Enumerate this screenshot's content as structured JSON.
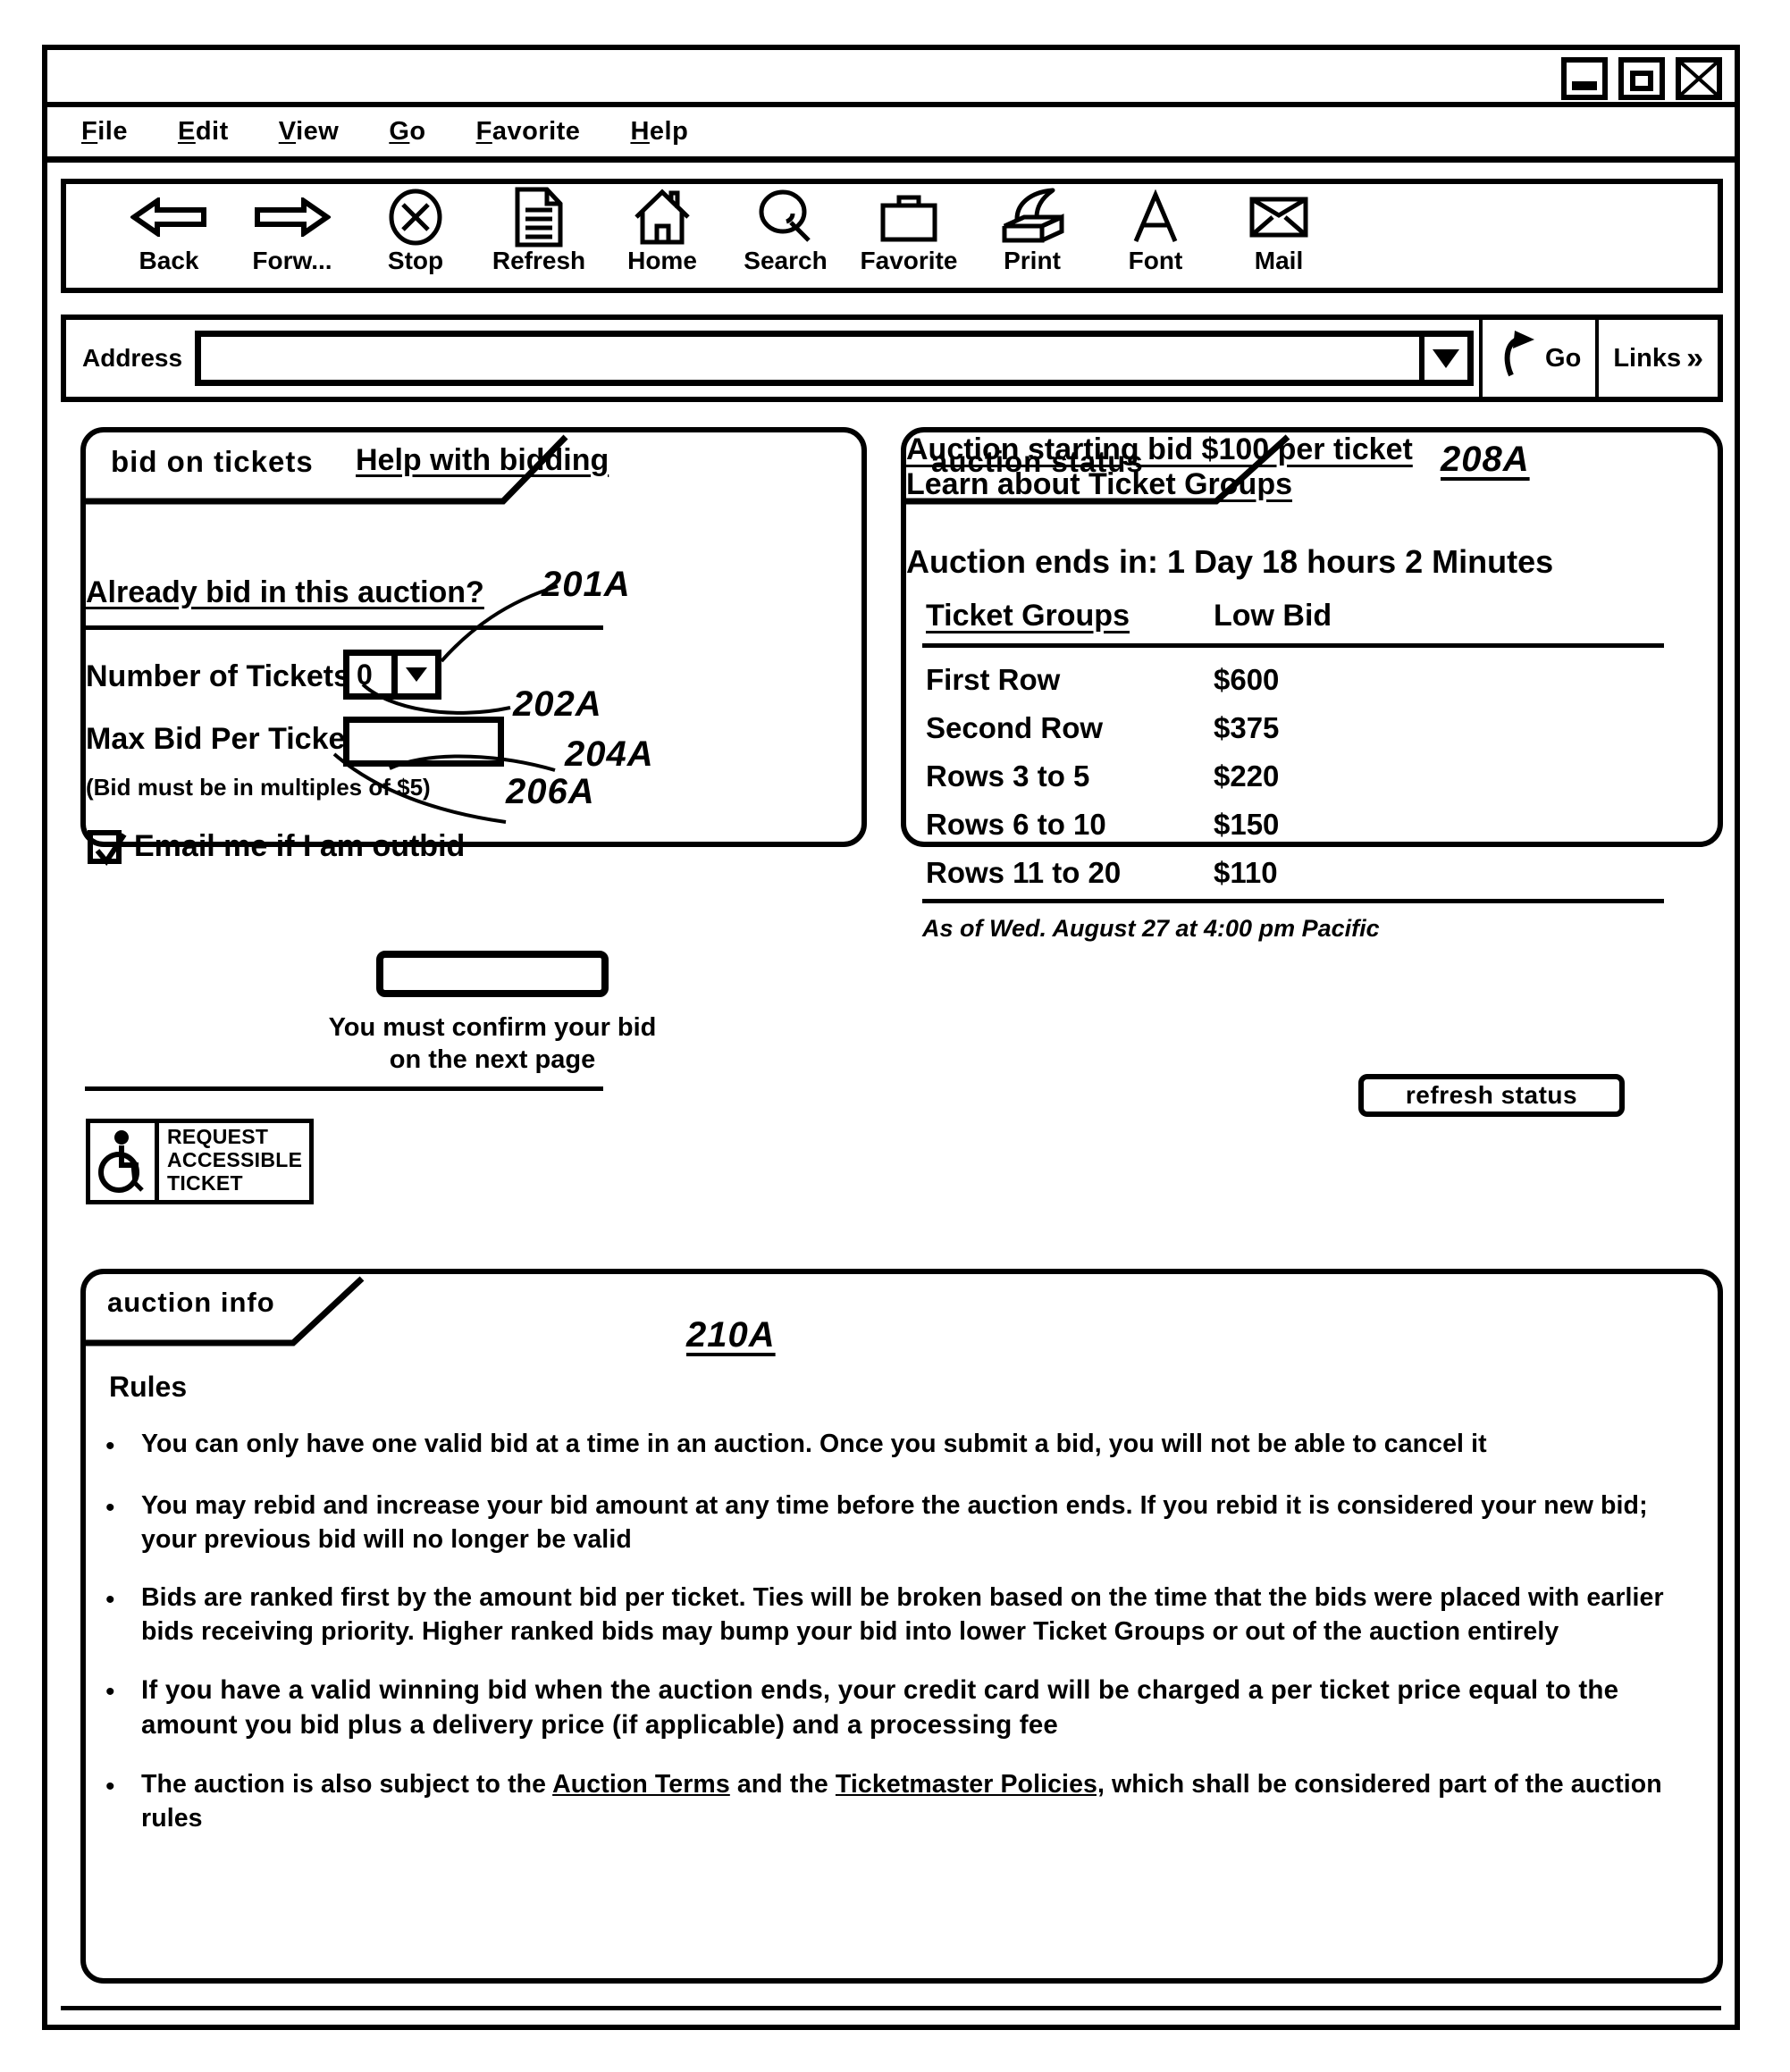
{
  "window": {
    "controls": [
      {
        "name": "minimize",
        "glyph": "minimize-icon"
      },
      {
        "name": "maximize",
        "glyph": "maximize-icon"
      },
      {
        "name": "close",
        "glyph": "close-icon"
      }
    ]
  },
  "menubar": {
    "items": [
      {
        "label": "File",
        "accel": "F"
      },
      {
        "label": "Edit",
        "accel": "E"
      },
      {
        "label": "View",
        "accel": "V"
      },
      {
        "label": "Go",
        "accel": "G"
      },
      {
        "label": "Favorite",
        "accel": "F"
      },
      {
        "label": "Help",
        "accel": "H"
      }
    ]
  },
  "toolbar": {
    "buttons": [
      {
        "label": "Back",
        "icon": "arrow-left-icon"
      },
      {
        "label": "Forw...",
        "icon": "arrow-right-icon"
      },
      {
        "label": "Stop",
        "icon": "stop-x-circle-icon"
      },
      {
        "label": "Refresh",
        "icon": "document-icon"
      },
      {
        "label": "Home",
        "icon": "house-icon"
      },
      {
        "label": "Search",
        "icon": "magnifier-icon"
      },
      {
        "label": "Favorite",
        "icon": "briefcase-icon"
      },
      {
        "label": "Print",
        "icon": "printer-icon"
      },
      {
        "label": "Font",
        "icon": "letter-a-icon"
      },
      {
        "label": "Mail",
        "icon": "envelope-icon"
      }
    ]
  },
  "address_bar": {
    "label": "Address",
    "value": "",
    "placeholder": "",
    "dropdown_icon": "chevron-down-icon",
    "go_label": "Go",
    "go_icon": "go-arrow-icon",
    "links_label": "Links",
    "links_icon": "double-chevron-right-icon"
  },
  "bid_panel": {
    "tab_title": "bid on tickets",
    "help_link": "Help with bidding",
    "already_bid_link": "Already bid in this auction?",
    "ref_already_bid": "201A",
    "tickets_label": "Number of Tickets:",
    "tickets_value": "0",
    "tickets_dropdown_icon": "chevron-down-icon",
    "ref_tickets": "202A",
    "max_bid_label": "Max Bid Per Ticket:",
    "currency_symbol": "$",
    "max_bid_value": "",
    "ref_max_bid": "204A",
    "multiples_note": "(Bid must be in multiples of $5)",
    "ref_multiples": "206A",
    "email_checkbox_label": "Email me if I am outbid",
    "email_checkbox_checked": true,
    "submit_button_label": "",
    "confirm_note_line1": "You must confirm your bid",
    "confirm_note_line2": "on the next page",
    "accessible_icon": "wheelchair-icon",
    "accessible_line1": "REQUEST",
    "accessible_line2": "ACCESSIBLE",
    "accessible_line3": "TICKET"
  },
  "status_panel": {
    "tab_title": "auction status",
    "ref_number": "208A",
    "ends_in": "Auction ends in: 1 Day 18 hours 2 Minutes",
    "col_group": "Ticket Groups",
    "col_bid": "Low Bid",
    "rows": [
      {
        "group": "First Row",
        "bid": "$600"
      },
      {
        "group": "Second Row",
        "bid": "$375"
      },
      {
        "group": "Rows 3 to 5",
        "bid": "$220"
      },
      {
        "group": "Rows 6 to 10",
        "bid": "$150"
      },
      {
        "group": "Rows 11 to 20",
        "bid": "$110"
      }
    ],
    "as_of": "As of Wed. August 27 at 4:00 pm Pacific",
    "starting_bid_link": "Auction starting bid $100 per ticket",
    "learn_link": "Learn about Ticket Groups",
    "refresh_button": "refresh status"
  },
  "info_panel": {
    "tab_title": "auction info",
    "ref_number": "210A",
    "rules_heading": "Rules",
    "bullet_glyph": "•",
    "rules": [
      {
        "text": "You can only have one valid bid at a time in an auction. Once you submit a bid, you will not be able to cancel it",
        "emphasis": false
      },
      {
        "text": "You may rebid and increase your bid amount at any time before the auction ends. If you rebid it is considered your new bid; your previous bid will no longer be valid",
        "emphasis": false
      },
      {
        "text": "Bids are ranked first by the amount bid per ticket. Ties will be broken based on the time that the bids were placed with earlier bids receiving priority. Higher ranked bids may bump your bid into lower Ticket Groups or out of the auction entirely",
        "emphasis": false
      },
      {
        "text": "If you have a valid winning bid when the auction ends, your credit card will be charged a per ticket price equal to the amount you bid plus a delivery price (if applicable) and a processing fee",
        "emphasis": true
      },
      {
        "prefix": "The auction is also subject to the ",
        "link1": "Auction Terms",
        "middle": " and the ",
        "link2": "Ticketmaster Policies,",
        "suffix": " which shall be considered part of the auction rules",
        "emphasis": false
      }
    ]
  }
}
